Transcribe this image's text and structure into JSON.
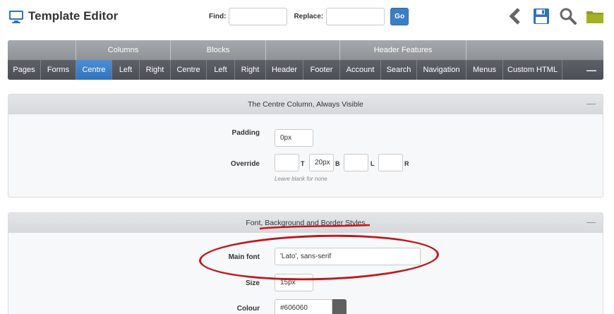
{
  "header": {
    "title": "Template Editor",
    "find_label": "Find:",
    "replace_label": "Replace:",
    "find_value": "",
    "replace_value": "",
    "go_label": "Go",
    "icons": [
      "chevron-left-icon",
      "save-icon",
      "search-icon",
      "folder-icon"
    ],
    "colors": {
      "accent": "#3a7fc4",
      "icon_grey": "#666666",
      "folder": "#8f9e1c"
    }
  },
  "nav": {
    "groups": [
      "",
      "Columns",
      "Blocks",
      "",
      "Header Features",
      ""
    ],
    "tabs": [
      "Pages",
      "Forms",
      "Centre",
      "Left",
      "Right",
      "Centre",
      "Left",
      "Right",
      "Header",
      "Footer",
      "Account",
      "Search",
      "Navigation",
      "Menus",
      "Custom HTML"
    ],
    "active_tab": "Centre",
    "collapse": "—"
  },
  "panel1": {
    "title": "The Centre Column, Always Visible",
    "collapse": "—",
    "padding_label": "Padding",
    "padding_value": "0px",
    "override_label": "Override",
    "override_t": "",
    "t_label": "T",
    "override_b": "20px",
    "b_label": "B",
    "override_l": "",
    "l_label": "L",
    "override_r": "",
    "r_label": "R",
    "hint": "Leave blank for none"
  },
  "panel2": {
    "title": "Font, Background and Border Styles",
    "collapse": "—",
    "main_font_label": "Main font",
    "main_font_value": "'Lato', sans-serif",
    "size_label": "Size",
    "size_value": "15px",
    "colour_label": "Colour",
    "colour_value": "#606060",
    "swatch_color": "#606060"
  }
}
